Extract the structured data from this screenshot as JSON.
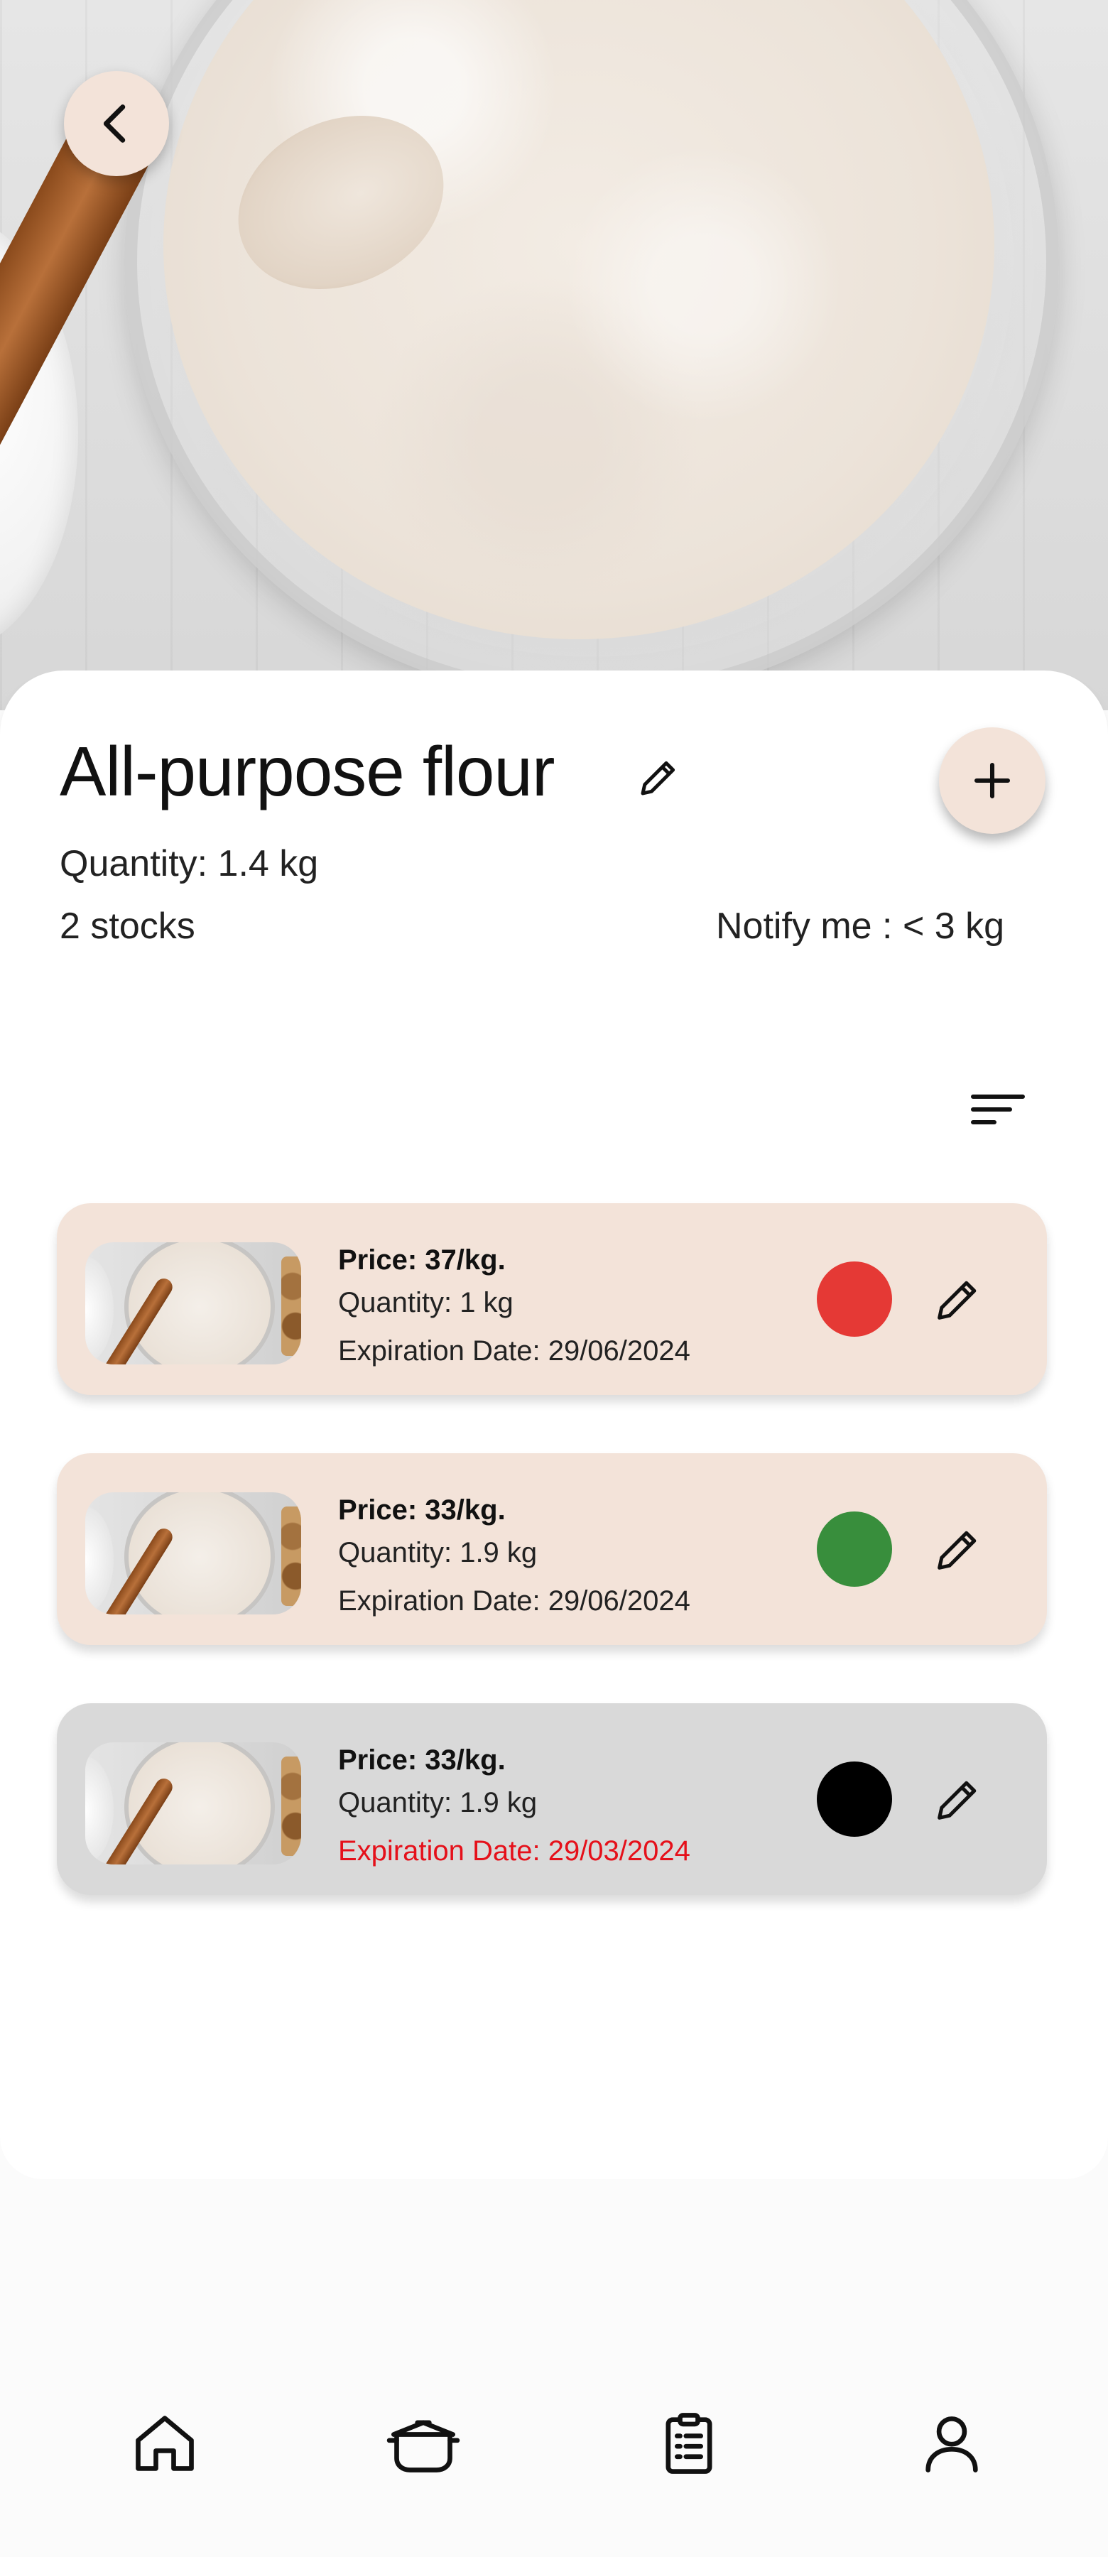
{
  "product": {
    "title": "All-purpose flour",
    "quantity": "Quantity: 1.4 kg",
    "stocks": "2 stocks",
    "notify": "Notify me : < 3 kg"
  },
  "stock_items": [
    {
      "price": "Price: 37/kg.",
      "quantity": "Quantity: 1 kg",
      "expiration": "Expiration Date: 29/06/2024",
      "status_color": "#e53935",
      "card_color": "#f3e3d9",
      "expired": false
    },
    {
      "price": "Price: 33/kg.",
      "quantity": "Quantity: 1.9 kg",
      "expiration": "Expiration Date: 29/06/2024",
      "status_color": "#388e3c",
      "card_color": "#f3e3d9",
      "expired": false
    },
    {
      "price": "Price: 33/kg.",
      "quantity": "Quantity: 1.9 kg",
      "expiration": "Expiration Date: 29/03/2024",
      "status_color": "#000000",
      "card_color": "#d9d9d9",
      "expired": true
    }
  ],
  "icons": {
    "back": "chevron-left-icon",
    "edit": "pencil-icon",
    "add": "plus-icon",
    "sort": "sort-icon"
  },
  "nav": {
    "items": [
      {
        "icon": "home-icon"
      },
      {
        "icon": "cooking-pot-icon"
      },
      {
        "icon": "clipboard-list-icon"
      },
      {
        "icon": "user-icon"
      }
    ]
  },
  "colors": {
    "accent": "#f3e3d9",
    "expired_text": "#e5101a",
    "card_grey": "#d9d9d9"
  }
}
